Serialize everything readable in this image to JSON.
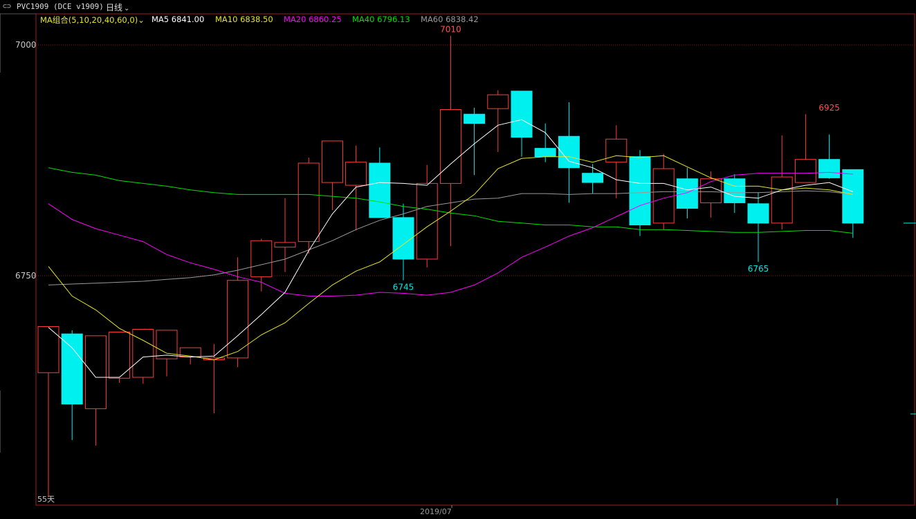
{
  "titlebar": {
    "icon": "⊂⊃",
    "symbol": "PVC1909 (DCE v1909)",
    "period": "日线",
    "period_chevron": "⌄"
  },
  "ma_legend": {
    "group_label": "MA组合(5,10,20,40,60,0)",
    "group_chevron": "⌄",
    "items": [
      {
        "text": "MA5 6841.00",
        "color": "#ffffff"
      },
      {
        "text": "MA10 6838.50",
        "color": "#e6e61e"
      },
      {
        "text": "MA20 6860.25",
        "color": "#ff00ff"
      },
      {
        "text": "MA40 6796.13",
        "color": "#00e000"
      },
      {
        "text": "MA60 6838.42",
        "color": "#9a9a9a"
      }
    ]
  },
  "colors": {
    "up": "#ff3c3c",
    "down": "#00f0f0",
    "grid": "#8b1a1a",
    "ma5": "#ffffff",
    "ma10": "#e6e61e",
    "ma20": "#ff00ff",
    "ma40": "#00e000",
    "ma60": "#9a9a9a"
  },
  "corner_note": "55天",
  "chart_data": {
    "type": "candlestick",
    "yticks": [
      7000,
      6750
    ],
    "ylim": [
      6505,
      7013
    ],
    "xlabel": "2019/07",
    "grid": true,
    "annotations": [
      {
        "text": "7010",
        "index": 17,
        "value": 7010,
        "color": "up",
        "pos": "above"
      },
      {
        "text": "6745",
        "index": 15,
        "value": 6745,
        "color": "down",
        "pos": "below"
      },
      {
        "text": "6765",
        "index": 30,
        "value": 6765,
        "color": "down",
        "pos": "below"
      },
      {
        "text": "6925",
        "index": 33,
        "value": 6925,
        "color": "up",
        "pos": "above"
      }
    ],
    "candles": [
      {
        "o": 6645,
        "h": 6688,
        "l": 6510,
        "c": 6695
      },
      {
        "o": 6687,
        "h": 6691,
        "l": 6572,
        "c": 6611
      },
      {
        "o": 6606,
        "h": 6669,
        "l": 6566,
        "c": 6685
      },
      {
        "o": 6639,
        "h": 6659,
        "l": 6634,
        "c": 6689
      },
      {
        "o": 6640,
        "h": 6669,
        "l": 6633,
        "c": 6692
      },
      {
        "o": 6660,
        "h": 6684,
        "l": 6641,
        "c": 6691
      },
      {
        "o": 6662,
        "h": 6660,
        "l": 6654,
        "c": 6672
      },
      {
        "o": 6659,
        "h": 6676,
        "l": 6601,
        "c": 6661
      },
      {
        "o": 6661,
        "h": 6770,
        "l": 6651,
        "c": 6745
      },
      {
        "o": 6749,
        "h": 6790,
        "l": 6733,
        "c": 6788
      },
      {
        "o": 6781,
        "h": 6834,
        "l": 6754,
        "c": 6786
      },
      {
        "o": 6787,
        "h": 6878,
        "l": 6774,
        "c": 6872
      },
      {
        "o": 6851,
        "h": 6867,
        "l": 6821,
        "c": 6896
      },
      {
        "o": 6848,
        "h": 6891,
        "l": 6799,
        "c": 6873
      },
      {
        "o": 6872,
        "h": 6889,
        "l": 6815,
        "c": 6813
      },
      {
        "o": 6813,
        "h": 6828,
        "l": 6745,
        "c": 6768
      },
      {
        "o": 6768,
        "h": 6870,
        "l": 6759,
        "c": 6850
      },
      {
        "o": 6850,
        "h": 7010,
        "l": 6782,
        "c": 6930
      },
      {
        "o": 6925,
        "h": 6932,
        "l": 6859,
        "c": 6915
      },
      {
        "o": 6931,
        "h": 6951,
        "l": 6884,
        "c": 6946
      },
      {
        "o": 6950,
        "h": 6904,
        "l": 6879,
        "c": 6900
      },
      {
        "o": 6888,
        "h": 6915,
        "l": 6873,
        "c": 6879
      },
      {
        "o": 6901,
        "h": 6938,
        "l": 6829,
        "c": 6867
      },
      {
        "o": 6861,
        "h": 6871,
        "l": 6839,
        "c": 6851
      },
      {
        "o": 6873,
        "h": 6913,
        "l": 6834,
        "c": 6898
      },
      {
        "o": 6879,
        "h": 6886,
        "l": 6793,
        "c": 6805
      },
      {
        "o": 6807,
        "h": 6882,
        "l": 6800,
        "c": 6866
      },
      {
        "o": 6855,
        "h": 6867,
        "l": 6812,
        "c": 6823
      },
      {
        "o": 6829,
        "h": 6863,
        "l": 6813,
        "c": 6855
      },
      {
        "o": 6855,
        "h": 6860,
        "l": 6818,
        "c": 6829
      },
      {
        "o": 6828,
        "h": 6840,
        "l": 6765,
        "c": 6807
      },
      {
        "o": 6807,
        "h": 6902,
        "l": 6800,
        "c": 6857
      },
      {
        "o": 6851,
        "h": 6925,
        "l": 6852,
        "c": 6876
      },
      {
        "o": 6876,
        "h": 6903,
        "l": 6855,
        "c": 6856
      },
      {
        "o": 6865,
        "h": 6863,
        "l": 6791,
        "c": 6807
      }
    ],
    "ma5": [
      6694,
      6672,
      6640,
      6640,
      6662,
      6664,
      6662,
      6663,
      6685,
      6708,
      6732,
      6777,
      6817,
      6846,
      6851,
      6850,
      6848,
      6871,
      6893,
      6913,
      6919,
      6905,
      6874,
      6867,
      6854,
      6850,
      6850,
      6843,
      6846,
      6836,
      6834,
      6843,
      6848,
      6851,
      6841
    ],
    "ma10": [
      6760,
      6728,
      6713,
      6693,
      6680,
      6666,
      6663,
      6659,
      6668,
      6686,
      6699,
      6720,
      6740,
      6755,
      6765,
      6784,
      6803,
      6820,
      6838,
      6866,
      6877,
      6879,
      6879,
      6873,
      6880,
      6878,
      6880,
      6868,
      6856,
      6847,
      6847,
      6843,
      6845,
      6843,
      6838
    ],
    "ma20": [
      6828,
      6811,
      6801,
      6794,
      6787,
      6773,
      6764,
      6757,
      6749,
      6743,
      6731,
      6728,
      6728,
      6729,
      6732,
      6731,
      6729,
      6732,
      6740,
      6753,
      6770,
      6781,
      6793,
      6802,
      6814,
      6826,
      6834,
      6840,
      6852,
      6859,
      6861,
      6861,
      6861,
      6862,
      6860
    ],
    "ma40": [
      6867,
      6862,
      6859,
      6853,
      6850,
      6847,
      6843,
      6840,
      6838,
      6838,
      6838,
      6838,
      6836,
      6834,
      6830,
      6825,
      6822,
      6818,
      6815,
      6809,
      6807,
      6805,
      6805,
      6803,
      6803,
      6800,
      6800,
      6799,
      6798,
      6797,
      6797,
      6798,
      6799,
      6799,
      6796
    ],
    "ma60": [
      6740,
      6741,
      6742,
      6743,
      6744,
      6746,
      6748,
      6751,
      6756,
      6762,
      6768,
      6778,
      6788,
      6800,
      6810,
      6817,
      6825,
      6829,
      6833,
      6834,
      6839,
      6839,
      6838,
      6839,
      6839,
      6840,
      6841,
      6841,
      6841,
      6840,
      6840,
      6841,
      6842,
      6841,
      6838
    ]
  }
}
